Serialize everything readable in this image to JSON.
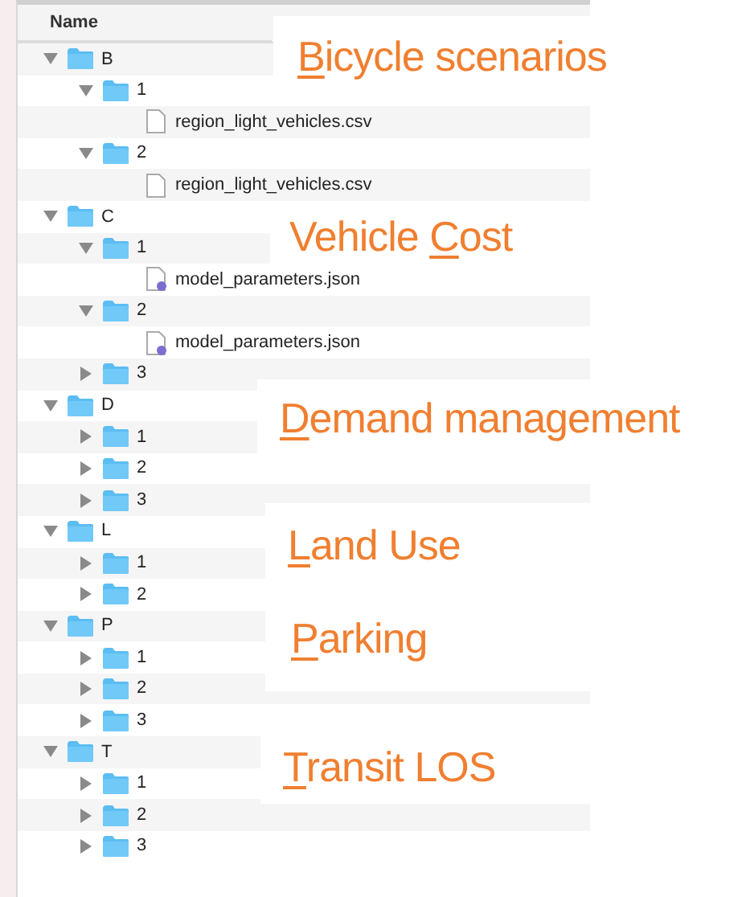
{
  "column_header": "Name",
  "tree": [
    {
      "kind": "folder",
      "label": "B",
      "expanded": true,
      "children": [
        {
          "kind": "folder",
          "label": "1",
          "expanded": true,
          "children": [
            {
              "kind": "plain_file",
              "label": "region_light_vehicles.csv"
            }
          ]
        },
        {
          "kind": "folder",
          "label": "2",
          "expanded": true,
          "children": [
            {
              "kind": "plain_file",
              "label": "region_light_vehicles.csv"
            }
          ]
        }
      ]
    },
    {
      "kind": "folder",
      "label": "C",
      "expanded": true,
      "children": [
        {
          "kind": "folder",
          "label": "1",
          "expanded": true,
          "children": [
            {
              "kind": "badge_file",
              "label": "model_parameters.json"
            }
          ]
        },
        {
          "kind": "folder",
          "label": "2",
          "expanded": true,
          "children": [
            {
              "kind": "badge_file",
              "label": "model_parameters.json"
            }
          ]
        },
        {
          "kind": "folder",
          "label": "3",
          "expanded": false
        }
      ]
    },
    {
      "kind": "folder",
      "label": "D",
      "expanded": true,
      "children": [
        {
          "kind": "folder",
          "label": "1",
          "expanded": false
        },
        {
          "kind": "folder",
          "label": "2",
          "expanded": false
        },
        {
          "kind": "folder",
          "label": "3",
          "expanded": false
        }
      ]
    },
    {
      "kind": "folder",
      "label": "L",
      "expanded": true,
      "children": [
        {
          "kind": "folder",
          "label": "1",
          "expanded": false
        },
        {
          "kind": "folder",
          "label": "2",
          "expanded": false
        }
      ]
    },
    {
      "kind": "folder",
      "label": "P",
      "expanded": true,
      "children": [
        {
          "kind": "folder",
          "label": "1",
          "expanded": false
        },
        {
          "kind": "folder",
          "label": "2",
          "expanded": false
        },
        {
          "kind": "folder",
          "label": "3",
          "expanded": false
        }
      ]
    },
    {
      "kind": "folder",
      "label": "T",
      "expanded": true,
      "children": [
        {
          "kind": "folder",
          "label": "1",
          "expanded": false
        },
        {
          "kind": "folder",
          "label": "2",
          "expanded": false
        },
        {
          "kind": "folder",
          "label": "3",
          "expanded": false
        }
      ]
    }
  ],
  "annotations": [
    {
      "segments": [
        {
          "text": "B",
          "underlined": true
        },
        {
          "text": "icycle scenarios",
          "underlined": false
        }
      ]
    },
    {
      "segments": [
        {
          "text": "Vehicle ",
          "underlined": false
        },
        {
          "text": "C",
          "underlined": true
        },
        {
          "text": "ost",
          "underlined": false
        }
      ]
    },
    {
      "segments": [
        {
          "text": "D",
          "underlined": true
        },
        {
          "text": "emand management",
          "underlined": false
        }
      ]
    },
    {
      "segments": [
        {
          "text": "L",
          "underlined": true
        },
        {
          "text": "and Use",
          "underlined": false
        }
      ]
    },
    {
      "segments": [
        {
          "text": "P",
          "underlined": true
        },
        {
          "text": "arking",
          "underlined": false
        }
      ]
    },
    {
      "segments": [
        {
          "text": "T",
          "underlined": true
        },
        {
          "text": "ransit LOS",
          "underlined": false
        }
      ]
    }
  ]
}
